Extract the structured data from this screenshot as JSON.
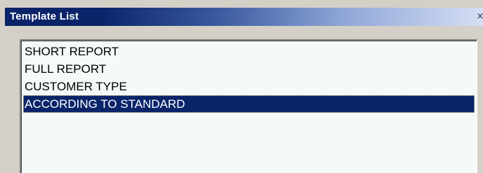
{
  "window": {
    "title": "Template List",
    "close_glyph": "×"
  },
  "template_list": {
    "items": [
      {
        "label": "SHORT REPORT",
        "selected": false
      },
      {
        "label": "FULL REPORT",
        "selected": false
      },
      {
        "label": "CUSTOMER TYPE",
        "selected": false
      },
      {
        "label": "ACCORDING TO STANDARD",
        "selected": true
      }
    ]
  },
  "colors": {
    "title_bar_start": "#0a246a",
    "title_bar_end": "#d6dff5",
    "selection_bg": "#0a246a",
    "selection_text": "#ffffff",
    "list_bg": "#f4faf8",
    "window_bg": "#d4d0c8"
  },
  "icons": {
    "close": "close-icon"
  }
}
